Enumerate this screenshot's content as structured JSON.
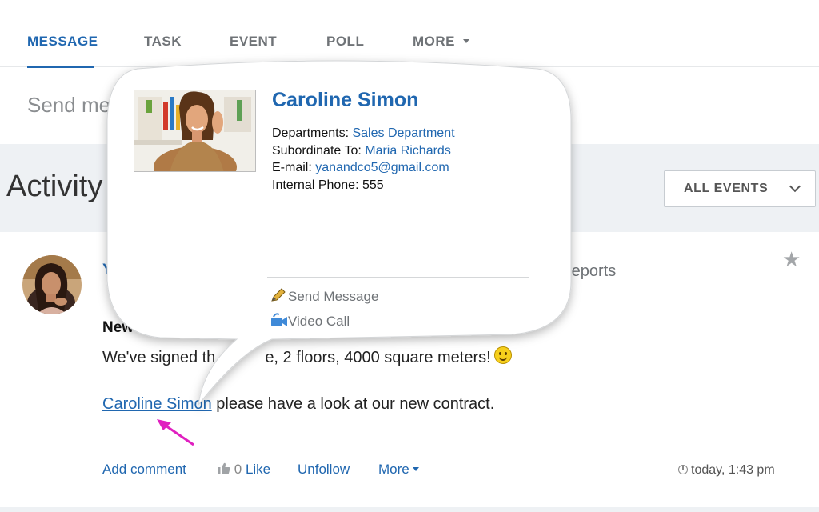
{
  "tabs": [
    {
      "label": "MESSAGE",
      "active": true
    },
    {
      "label": "TASK",
      "active": false
    },
    {
      "label": "EVENT",
      "active": false
    },
    {
      "label": "POLL",
      "active": false
    },
    {
      "label": "MORE",
      "active": false
    }
  ],
  "composer": {
    "placeholder": "Send me"
  },
  "activity": {
    "title": "Activity",
    "filter_label": "ALL EVENTS"
  },
  "post": {
    "author_visible": "Y",
    "destination_fragment": "reports",
    "title_fragment": "New",
    "line1_start": "We've signed th",
    "line1_end": "e, 2 floors, 4000 square meters!",
    "mention": "Caroline Simon",
    "line2_rest": " please have a look at our new contract.",
    "actions": {
      "add_comment": "Add comment",
      "like_count": "0",
      "like": "Like",
      "unfollow": "Unfollow",
      "more": "More"
    },
    "time": "today, 1:43 pm"
  },
  "user_card": {
    "name": "Caroline Simon",
    "departments_label": "Departments: ",
    "departments_value": "Sales Department",
    "subordinate_label": "Subordinate To: ",
    "subordinate_value": "Maria Richards",
    "email_label": "E-mail: ",
    "email_value": "yanandco5@gmail.com",
    "phone_label": "Internal Phone: ",
    "phone_value": "555",
    "send_message": "Send Message",
    "video_call": "Video Call"
  },
  "colors": {
    "accent": "#2067b0",
    "annotation_arrow": "#e020c0",
    "panel_bg": "#eef1f4"
  },
  "icons": [
    "star-icon",
    "thumbs-up-icon",
    "clock-icon",
    "pencil-icon",
    "video-call-icon",
    "smiley-icon",
    "chevron-down-icon"
  ]
}
